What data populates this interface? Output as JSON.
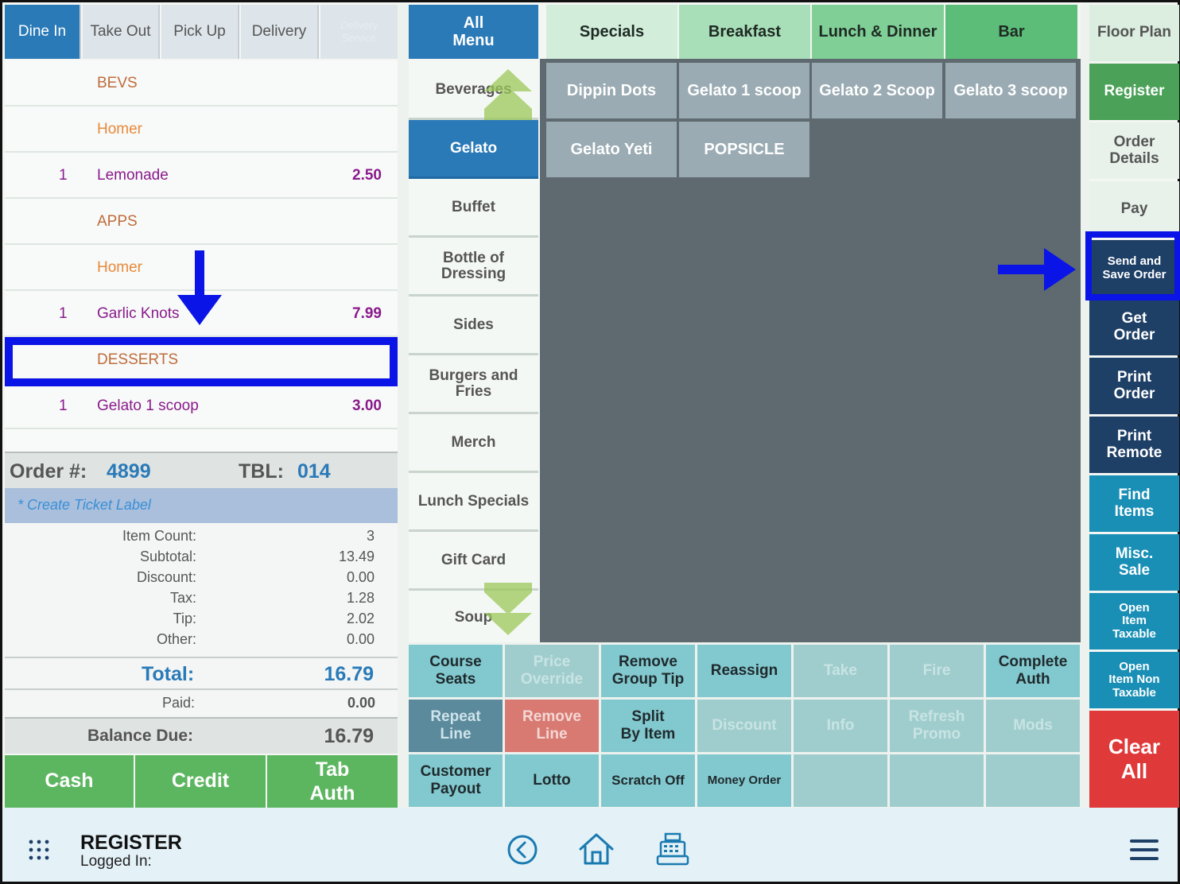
{
  "order_type_tabs": [
    "Dine In",
    "Take Out",
    "Pick Up",
    "Delivery",
    "Delivery\nService"
  ],
  "order_lines": [
    {
      "qty": "",
      "name": "BEVS",
      "price": "",
      "kind": "sec"
    },
    {
      "qty": "",
      "name": "Homer",
      "price": "",
      "kind": "srv"
    },
    {
      "qty": "1",
      "name": "Lemonade",
      "price": "2.50",
      "kind": "itm"
    },
    {
      "qty": "",
      "name": "APPS",
      "price": "",
      "kind": "sec"
    },
    {
      "qty": "",
      "name": "Homer",
      "price": "",
      "kind": "srv"
    },
    {
      "qty": "1",
      "name": "Garlic Knots",
      "price": "7.99",
      "kind": "itm"
    },
    {
      "qty": "",
      "name": "DESSERTS",
      "price": "",
      "kind": "sec"
    },
    {
      "qty": "1",
      "name": "Gelato 1 scoop",
      "price": "3.00",
      "kind": "itm"
    }
  ],
  "order_info": {
    "order_label": "Order #:",
    "order_number": "4899",
    "table_label": "TBL:",
    "table_number": "014",
    "ticket_label": "* Create Ticket Label"
  },
  "summary": [
    {
      "label": "Item Count:",
      "value": "3"
    },
    {
      "label": "Subtotal:",
      "value": "13.49"
    },
    {
      "label": "Discount:",
      "value": "0.00"
    },
    {
      "label": "Tax:",
      "value": "1.28"
    },
    {
      "label": "Tip:",
      "value": "2.02"
    },
    {
      "label": "Other:",
      "value": "0.00"
    }
  ],
  "total": {
    "label": "Total:",
    "value": "16.79"
  },
  "paid": {
    "label": "Paid:",
    "value": "0.00"
  },
  "balance": {
    "label": "Balance Due:",
    "value": "16.79"
  },
  "payment_buttons": [
    "Cash",
    "Credit",
    "Tab\nAuth"
  ],
  "all_menu": "All\nMenu",
  "menu_tabs": [
    "Specials",
    "Breakfast",
    "Lunch & Dinner",
    "Bar"
  ],
  "categories": [
    "Beverages",
    "Gelato",
    "Buffet",
    "Bottle of\nDressing",
    "Sides",
    "Burgers and\nFries",
    "Merch",
    "Lunch Specials",
    "Gift Card",
    "Soup"
  ],
  "items": [
    "Dippin Dots",
    "Gelato 1 scoop",
    "Gelato 2 Scoop",
    "Gelato 3 scoop",
    "Gelato Yeti",
    "POPSICLE"
  ],
  "function_rows": [
    [
      "Course\nSeats",
      "Price\nOverride",
      "Remove\nGroup Tip",
      "Reassign",
      "Take",
      "Fire",
      "Complete\nAuth"
    ],
    [
      "Repeat\nLine",
      "Remove\nLine",
      "Split\nBy Item",
      "Discount",
      "Info",
      "Refresh\nPromo",
      "Mods"
    ],
    [
      "Customer\nPayout",
      "Lotto",
      "Scratch Off",
      "Money Order",
      "",
      "",
      ""
    ]
  ],
  "right_buttons": [
    "Floor Plan",
    "Register",
    "Order\nDetails",
    "Pay",
    "Send and\nSave Order",
    "Get\nOrder",
    "Print\nOrder",
    "Print\nRemote",
    "Find\nItems",
    "Misc.\nSale",
    "Open\nItem\nTaxable",
    "Open\nItem Non\nTaxable",
    "Clear\nAll"
  ],
  "footer": {
    "title": "REGISTER",
    "subtitle": "Logged In:"
  },
  "colors": {
    "blue": "#2a7ab8",
    "green": "#5cb660",
    "dark_navy": "#1e3f66",
    "teal": "#1a8fb6",
    "red": "#e0393a",
    "annotation": "#0a14e6",
    "grey_area": "#5f6a70"
  }
}
